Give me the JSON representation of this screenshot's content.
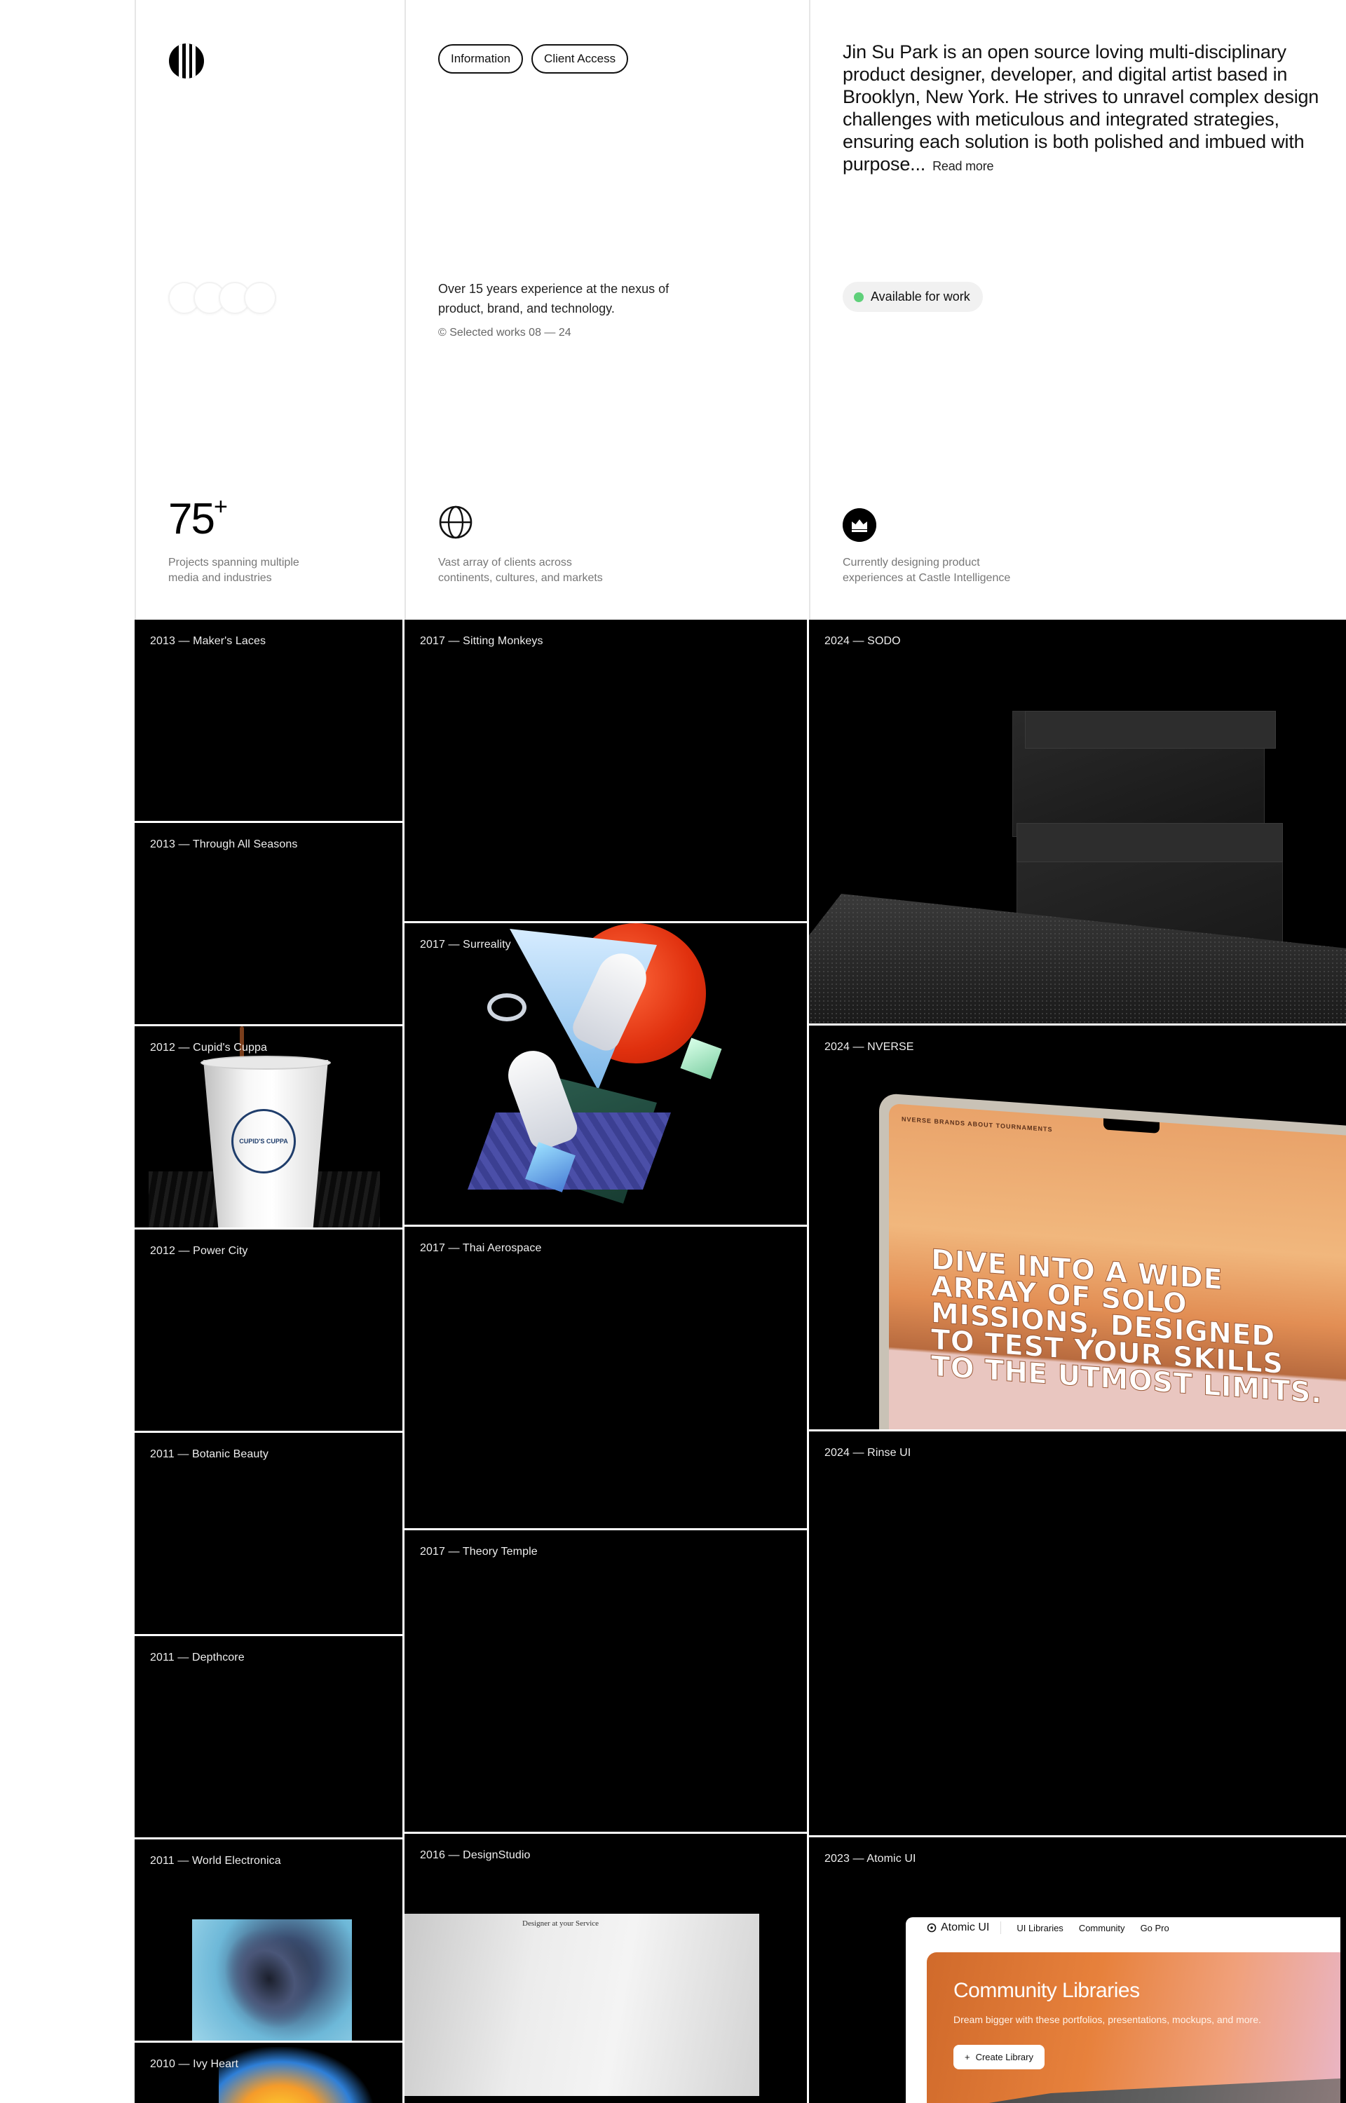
{
  "header": {
    "nav": [
      {
        "label": "Information"
      },
      {
        "label": "Client Access"
      }
    ],
    "experience": "Over 15 years experience at the nexus of product, brand, and technology.",
    "selected_works": "© Selected works 08 — 24",
    "bio": "Jin Su Park is an open source loving multi-disciplinary product designer, developer, and digital artist based in Brooklyn, New York. He strives to unravel complex design challenges with meticulous and integrated strategies, ensuring each solution is both polished and imbued with purpose...",
    "read_more": "Read more",
    "availability": "Available for work",
    "availability_color": "#5fd07a"
  },
  "stats": [
    {
      "value": "75",
      "suffix": "+",
      "caption": "Projects spanning multiple media and industries"
    },
    {
      "icon": "globe-icon",
      "caption": "Vast array of clients across continents, cultures, and markets"
    },
    {
      "icon": "crown-badge-icon",
      "caption": "Currently designing product experiences at Castle Intelligence"
    }
  ],
  "works": {
    "column_1": [
      {
        "label": "2013 — Maker's Laces"
      },
      {
        "label": "2013 — Through All Seasons"
      },
      {
        "label": "2012 — Cupid's Cuppa"
      },
      {
        "label": "2012 — Power City"
      },
      {
        "label": "2011 — Botanic Beauty"
      },
      {
        "label": "2011 — Depthcore"
      },
      {
        "label": "2011 — World Electronica"
      },
      {
        "label": "2010 — Ivy Heart"
      }
    ],
    "column_2": [
      {
        "label": "2017 — Sitting Monkeys"
      },
      {
        "label": "2017 — Surreality"
      },
      {
        "label": "2017 — Thai Aerospace"
      },
      {
        "label": "2017 — Theory Temple"
      },
      {
        "label": "2016 — DesignStudio"
      }
    ],
    "column_3": [
      {
        "label": "2024 — SODO"
      },
      {
        "label": "2024 — NVERSE"
      },
      {
        "label": "2024 — Rinse UI"
      },
      {
        "label": "2023 — Atomic UI"
      }
    ]
  },
  "artwork_text": {
    "cuppa_brand": "CUPID'S CUPPA",
    "nverse_nav": "NVERSE   BRANDS   ABOUT   TOURNAMENTS",
    "nverse_headline": "DIVE INTO A WIDE ARRAY OF SOLO MISSIONS, DESIGNED TO TEST YOUR SKILLS TO THE UTMOST LIMITS.",
    "designstudio_shirt": "Designer at your Service",
    "atomic": {
      "brand": "Atomic UI",
      "nav": [
        "UI Libraries",
        "Community",
        "Go Pro"
      ],
      "title": "Community Libraries",
      "subtitle": "Dream bigger with these portfolios, presentations, mockups, and more.",
      "button": "Create Library"
    }
  }
}
